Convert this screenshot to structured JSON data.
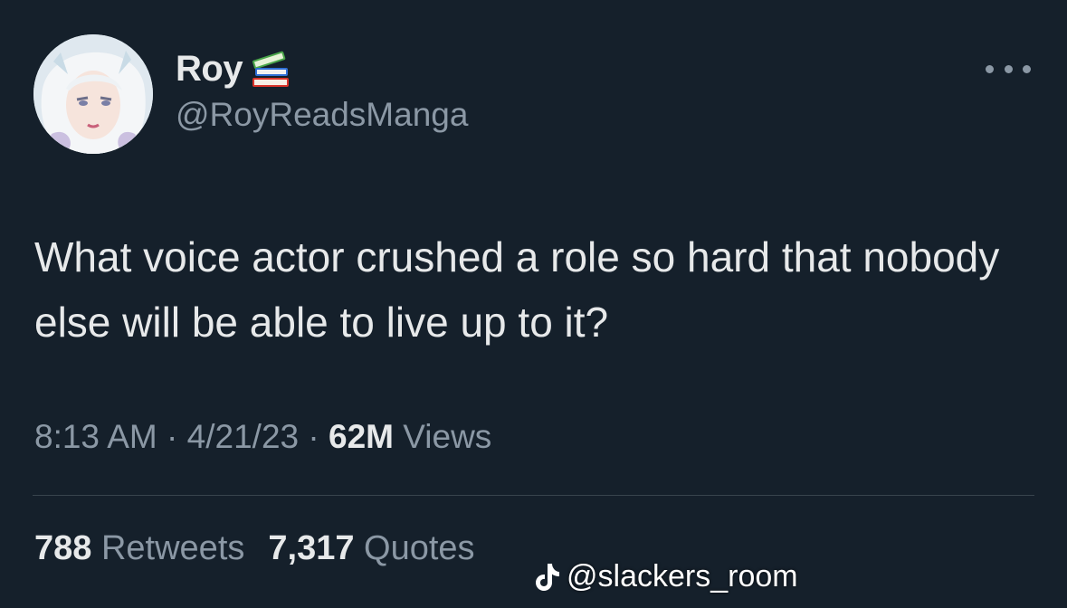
{
  "user": {
    "display_name": "Roy",
    "name_emoji": "books-icon",
    "handle": "@RoyReadsManga",
    "avatar": "anime-character-avatar"
  },
  "tweet": {
    "text": "What voice actor crushed a role so hard that nobody else will be able to live up to it?"
  },
  "meta": {
    "time": "8:13 AM",
    "separator": " · ",
    "date": "4/21/23",
    "views_count": "62M",
    "views_label": "Views"
  },
  "stats": {
    "retweets_count": "788",
    "retweets_label": "Retweets",
    "quotes_count": "7,317",
    "quotes_label": "Quotes"
  },
  "watermark": {
    "icon": "tiktok-icon",
    "text": "@slackers_room"
  },
  "colors": {
    "background": "#15202b",
    "primary_text": "#e7e9ea",
    "secondary_text": "#8b98a5",
    "divider": "#38444d"
  }
}
